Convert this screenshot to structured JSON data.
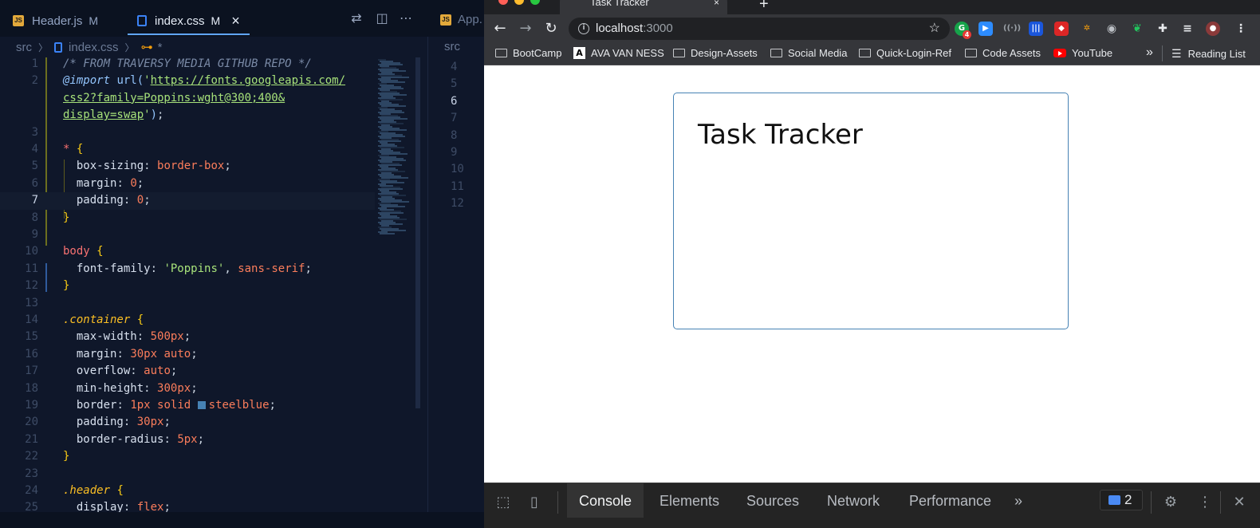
{
  "editor": {
    "tabs": [
      {
        "label": "Header.js",
        "badge": "JS",
        "status": "M"
      },
      {
        "label": "index.css",
        "status": "M",
        "close": "×"
      }
    ],
    "split_tab_label": "App.",
    "breadcrumb": {
      "folder": "src",
      "file": "index.css",
      "symbol_star": "*"
    },
    "right_breadcrumb": "src",
    "code_lines": [
      {
        "n": "1",
        "html": "<span class=\"c-com\">/* FROM TRAVERSY MEDIA GITHUB REPO */</span>"
      },
      {
        "n": "2",
        "html": "<span class=\"c-at\">@import</span> <span class=\"c-fn\">url(</span><span class=\"c-str2\">'</span><span class=\"c-str\">https://fonts.googleapis.com/</span>"
      },
      {
        "n": "",
        "html": "<span class=\"c-str\">css2?family=Poppins:wght@300;400&amp;</span>"
      },
      {
        "n": "",
        "html": "<span class=\"c-str\">display=swap</span><span class=\"c-str2\">'</span><span class=\"c-fn\">)</span><span class=\"c-p\">;</span>"
      },
      {
        "n": "3",
        "html": ""
      },
      {
        "n": "4",
        "html": "<span class=\"c-sel\">*</span> <span class=\"c-br\">{</span>"
      },
      {
        "n": "5",
        "html": "  <span class=\"c-prop\">box-sizing</span><span class=\"c-p\">:</span> <span class=\"c-val\">border-box</span><span class=\"c-p\">;</span>"
      },
      {
        "n": "6",
        "html": "  <span class=\"c-prop\">margin</span><span class=\"c-p\">:</span> <span class=\"c-num\">0</span><span class=\"c-p\">;</span>"
      },
      {
        "n": "7",
        "html": "  <span class=\"c-prop\">padding</span><span class=\"c-p\">:</span> <span class=\"c-num\">0</span><span class=\"c-p\">;</span>",
        "active": true
      },
      {
        "n": "8",
        "html": "<span class=\"c-br\">}</span>"
      },
      {
        "n": "9",
        "html": ""
      },
      {
        "n": "10",
        "html": "<span class=\"c-sel\">body</span> <span class=\"c-br\">{</span>"
      },
      {
        "n": "11",
        "html": "  <span class=\"c-prop\">font-family</span><span class=\"c-p\">:</span> <span class=\"c-str2\">'Poppins'</span><span class=\"c-p\">,</span> <span class=\"c-val\">sans-serif</span><span class=\"c-p\">;</span>"
      },
      {
        "n": "12",
        "html": "<span class=\"c-br\">}</span>"
      },
      {
        "n": "13",
        "html": ""
      },
      {
        "n": "14",
        "html": "<span class=\"c-cls\">.container</span> <span class=\"c-br\">{</span>"
      },
      {
        "n": "15",
        "html": "  <span class=\"c-prop\">max-width</span><span class=\"c-p\">:</span> <span class=\"c-num\">500px</span><span class=\"c-p\">;</span>"
      },
      {
        "n": "16",
        "html": "  <span class=\"c-prop\">margin</span><span class=\"c-p\">:</span> <span class=\"c-num\">30px</span> <span class=\"c-val\">auto</span><span class=\"c-p\">;</span>"
      },
      {
        "n": "17",
        "html": "  <span class=\"c-prop\">overflow</span><span class=\"c-p\">:</span> <span class=\"c-val\">auto</span><span class=\"c-p\">;</span>"
      },
      {
        "n": "18",
        "html": "  <span class=\"c-prop\">min-height</span><span class=\"c-p\">:</span> <span class=\"c-num\">300px</span><span class=\"c-p\">;</span>"
      },
      {
        "n": "19",
        "html": "  <span class=\"c-prop\">border</span><span class=\"c-p\">:</span> <span class=\"c-num\">1px</span> <span class=\"c-val\">solid</span> <span class=\"swatch\"></span><span class=\"c-val\">steelblue</span><span class=\"c-p\">;</span>"
      },
      {
        "n": "20",
        "html": "  <span class=\"c-prop\">padding</span><span class=\"c-p\">:</span> <span class=\"c-num\">30px</span><span class=\"c-p\">;</span>"
      },
      {
        "n": "21",
        "html": "  <span class=\"c-prop\">border-radius</span><span class=\"c-p\">:</span> <span class=\"c-num\">5px</span><span class=\"c-p\">;</span>"
      },
      {
        "n": "22",
        "html": "<span class=\"c-br\">}</span>"
      },
      {
        "n": "23",
        "html": ""
      },
      {
        "n": "24",
        "html": "<span class=\"c-cls\">.header</span> <span class=\"c-br\">{</span>"
      },
      {
        "n": "25",
        "html": "  <span class=\"c-prop\">display</span><span class=\"c-p\">:</span> <span class=\"c-val\">flex</span><span class=\"c-p\">;</span>"
      }
    ],
    "right_line_numbers": [
      "4",
      "5",
      "6",
      "7",
      "8",
      "9",
      "10",
      "11",
      "12"
    ]
  },
  "browser": {
    "tab_title": "Task Tracker",
    "tab_close": "×",
    "new_tab": "+",
    "url_host": "localhost",
    "url_port": ":3000",
    "extension_badge": "4",
    "bookmarks": [
      {
        "label": "BootCamp",
        "icon": "folder-icon"
      },
      {
        "label": "AVA VAN NESS",
        "icon": "ava-icon"
      },
      {
        "label": "Design-Assets",
        "icon": "folder-icon"
      },
      {
        "label": "Social Media",
        "icon": "folder-icon"
      },
      {
        "label": "Quick-Login-Ref",
        "icon": "folder-icon"
      },
      {
        "label": "Code Assets",
        "icon": "folder-icon"
      },
      {
        "label": "YouTube",
        "icon": "youtube-icon"
      }
    ],
    "more_bookmarks": "»",
    "reading_list": "Reading List",
    "page": {
      "title": "Task Tracker"
    },
    "devtools": {
      "tabs": [
        "Console",
        "Elements",
        "Sources",
        "Network",
        "Performance"
      ],
      "more": "»",
      "issues_count": "2"
    }
  },
  "colors": {
    "editor_bg": "#0f172a",
    "container_border": "#4682b4",
    "accent": "#60a5fa"
  }
}
